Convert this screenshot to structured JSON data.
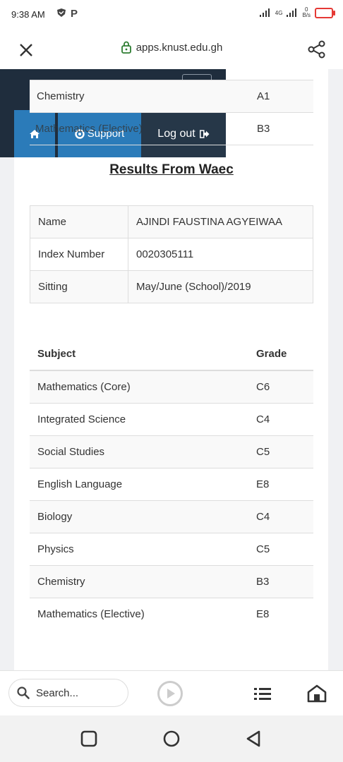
{
  "status_bar": {
    "time": "9:38 AM",
    "network_type": "4G",
    "data_speed_value": "0",
    "data_speed_unit": "B/s"
  },
  "browser": {
    "url": "apps.knust.edu.gh"
  },
  "navbar": {
    "support_label": "Support",
    "logout_label": "Log out"
  },
  "overlay_rows": [
    {
      "subject": "Chemistry",
      "grade": "A1"
    },
    {
      "subject": "Mathematics (Elective)",
      "grade": "B3"
    }
  ],
  "page_title": "Results From Waec",
  "candidate": {
    "name_label": "Name",
    "name_value": "AJINDI FAUSTINA AGYEIWAA",
    "index_label": "Index Number",
    "index_value": "0020305111",
    "sitting_label": "Sitting",
    "sitting_value": "May/June (School)/2019"
  },
  "results_table": {
    "headers": [
      "Subject",
      "Grade"
    ],
    "rows": [
      {
        "subject": "Mathematics (Core)",
        "grade": "C6"
      },
      {
        "subject": "Integrated Science",
        "grade": "C4"
      },
      {
        "subject": "Social Studies",
        "grade": "C5"
      },
      {
        "subject": "English Language",
        "grade": "E8"
      },
      {
        "subject": "Biology",
        "grade": "C4"
      },
      {
        "subject": "Physics",
        "grade": "C5"
      },
      {
        "subject": "Chemistry",
        "grade": "B3"
      },
      {
        "subject": "Mathematics (Elective)",
        "grade": "E8"
      }
    ]
  },
  "bottom_bar": {
    "search_placeholder": "Search..."
  },
  "colors": {
    "nav_dark": "#1f2d3d",
    "nav_blue": "#2b7bb9",
    "battery_red": "#e53935"
  }
}
